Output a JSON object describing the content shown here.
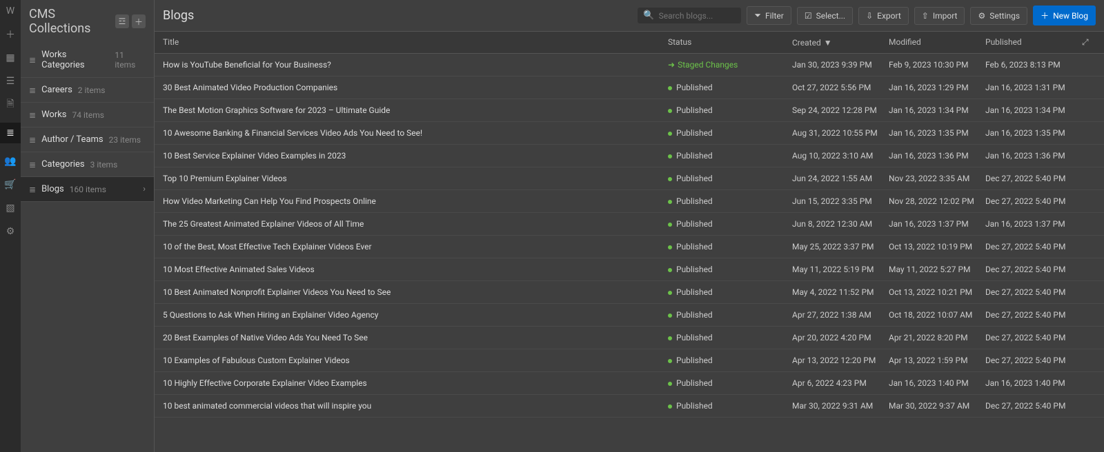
{
  "sidebar": {
    "heading": "CMS Collections",
    "collections": [
      {
        "name": "Works Categories",
        "count": "11 items"
      },
      {
        "name": "Careers",
        "count": "2 items"
      },
      {
        "name": "Works",
        "count": "74 items"
      },
      {
        "name": "Author / Teams",
        "count": "23 items"
      },
      {
        "name": "Categories",
        "count": "3 items"
      },
      {
        "name": "Blogs",
        "count": "160 items"
      }
    ],
    "active_index": 5
  },
  "main": {
    "title": "Blogs",
    "search_placeholder": "Search blogs...",
    "buttons": {
      "filter": "Filter",
      "select": "Select...",
      "export": "Export",
      "import": "Import",
      "settings": "Settings",
      "new": "New Blog"
    },
    "columns": {
      "title": "Title",
      "status": "Status",
      "created": "Created",
      "modified": "Modified",
      "published": "Published"
    },
    "rows": [
      {
        "title": "How is YouTube Beneficial for Your Business?",
        "status": "Staged Changes",
        "staged": true,
        "created": "Jan 30, 2023 9:39 PM",
        "modified": "Feb 9, 2023 10:30 PM",
        "published": "Feb 6, 2023 8:13 PM"
      },
      {
        "title": "30 Best Animated Video Production Companies",
        "status": "Published",
        "created": "Oct 27, 2022 5:56 PM",
        "modified": "Jan 16, 2023 1:29 PM",
        "published": "Jan 16, 2023 1:31 PM"
      },
      {
        "title": "The Best Motion Graphics Software for 2023 – Ultimate Guide",
        "status": "Published",
        "created": "Sep 24, 2022 12:28 PM",
        "modified": "Jan 16, 2023 1:34 PM",
        "published": "Jan 16, 2023 1:34 PM"
      },
      {
        "title": "10 Awesome Banking & Financial Services Video Ads You Need to See!",
        "status": "Published",
        "created": "Aug 31, 2022 10:55 PM",
        "modified": "Jan 16, 2023 1:35 PM",
        "published": "Jan 16, 2023 1:35 PM"
      },
      {
        "title": "10 Best Service Explainer Video Examples in 2023",
        "status": "Published",
        "created": "Aug 10, 2022 3:10 AM",
        "modified": "Jan 16, 2023 1:36 PM",
        "published": "Jan 16, 2023 1:36 PM"
      },
      {
        "title": "Top 10 Premium Explainer Videos",
        "status": "Published",
        "created": "Jun 24, 2022 1:55 AM",
        "modified": "Nov 23, 2022 3:35 AM",
        "published": "Dec 27, 2022 5:40 PM"
      },
      {
        "title": "How Video Marketing Can Help You Find Prospects Online",
        "status": "Published",
        "created": "Jun 15, 2022 3:35 PM",
        "modified": "Nov 28, 2022 12:02 PM",
        "published": "Dec 27, 2022 5:40 PM"
      },
      {
        "title": "The 25 Greatest Animated Explainer Videos of All Time",
        "status": "Published",
        "created": "Jun 8, 2022 12:30 AM",
        "modified": "Jan 16, 2023 1:37 PM",
        "published": "Jan 16, 2023 1:37 PM"
      },
      {
        "title": "10 of the Best, Most Effective Tech Explainer Videos Ever",
        "status": "Published",
        "created": "May 25, 2022 3:37 PM",
        "modified": "Oct 13, 2022 10:19 PM",
        "published": "Dec 27, 2022 5:40 PM"
      },
      {
        "title": "10 Most Effective Animated Sales Videos",
        "status": "Published",
        "created": "May 11, 2022 5:19 PM",
        "modified": "May 11, 2022 5:27 PM",
        "published": "Dec 27, 2022 5:40 PM"
      },
      {
        "title": "10 Best Animated Nonprofit Explainer Videos You Need to See",
        "status": "Published",
        "created": "May 4, 2022 11:52 PM",
        "modified": "Oct 13, 2022 10:21 PM",
        "published": "Dec 27, 2022 5:40 PM"
      },
      {
        "title": "5 Questions to Ask When Hiring an Explainer Video Agency",
        "status": "Published",
        "created": "Apr 27, 2022 1:38 AM",
        "modified": "Oct 18, 2022 10:07 AM",
        "published": "Dec 27, 2022 5:40 PM"
      },
      {
        "title": "20 Best Examples of Native Video Ads You Need To See",
        "status": "Published",
        "created": "Apr 20, 2022 4:20 PM",
        "modified": "Apr 21, 2022 8:20 PM",
        "published": "Dec 27, 2022 5:40 PM"
      },
      {
        "title": "10 Examples of Fabulous Custom Explainer Videos",
        "status": "Published",
        "created": "Apr 13, 2022 12:20 PM",
        "modified": "Apr 13, 2022 1:59 PM",
        "published": "Dec 27, 2022 5:40 PM"
      },
      {
        "title": "10 Highly Effective Corporate Explainer Video Examples",
        "status": "Published",
        "created": "Apr 6, 2022 4:23 PM",
        "modified": "Jan 16, 2023 1:40 PM",
        "published": "Jan 16, 2023 1:40 PM"
      },
      {
        "title": "10 best animated commercial videos that will inspire you",
        "status": "Published",
        "created": "Mar 30, 2022 9:31 AM",
        "modified": "Mar 30, 2022 9:37 AM",
        "published": "Dec 27, 2022 5:40 PM"
      }
    ]
  }
}
